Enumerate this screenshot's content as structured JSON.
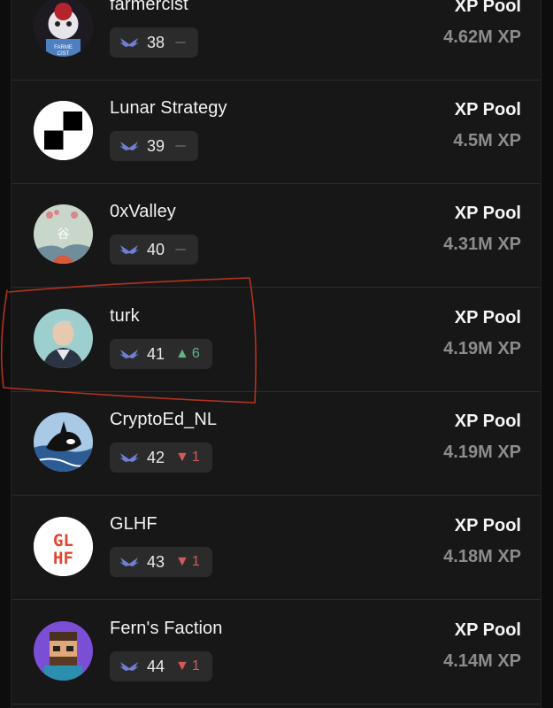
{
  "leaderboard": {
    "xp_label": "XP Pool",
    "entries": [
      {
        "name": "farmercist",
        "rank": "38",
        "change_type": "same",
        "change": "",
        "xp": "4.62M XP",
        "avatar": "farmercist-avatar"
      },
      {
        "name": "Lunar Strategy",
        "rank": "39",
        "change_type": "same",
        "change": "",
        "xp": "4.5M XP",
        "avatar": "lunar-strategy-avatar"
      },
      {
        "name": "0xValley",
        "rank": "40",
        "change_type": "same",
        "change": "",
        "xp": "4.31M XP",
        "avatar": "valley-avatar"
      },
      {
        "name": "turk",
        "rank": "41",
        "change_type": "up",
        "change": "6",
        "xp": "4.19M XP",
        "avatar": "turk-avatar"
      },
      {
        "name": "CryptoEd_NL",
        "rank": "42",
        "change_type": "down",
        "change": "1",
        "xp": "4.19M XP",
        "avatar": "orca-avatar"
      },
      {
        "name": "GLHF",
        "rank": "43",
        "change_type": "down",
        "change": "1",
        "xp": "4.18M XP",
        "avatar": "glhf-avatar"
      },
      {
        "name": "Fern's Faction",
        "rank": "44",
        "change_type": "down",
        "change": "1",
        "xp": "4.14M XP",
        "avatar": "pixel-avatar"
      }
    ]
  },
  "colors": {
    "background": "#171717",
    "pill": "#2b2b2b",
    "up": "#5fb48a",
    "down": "#d35a5a",
    "highlight_stroke": "#b2321f",
    "rank_icon": "#6e7fd6"
  }
}
